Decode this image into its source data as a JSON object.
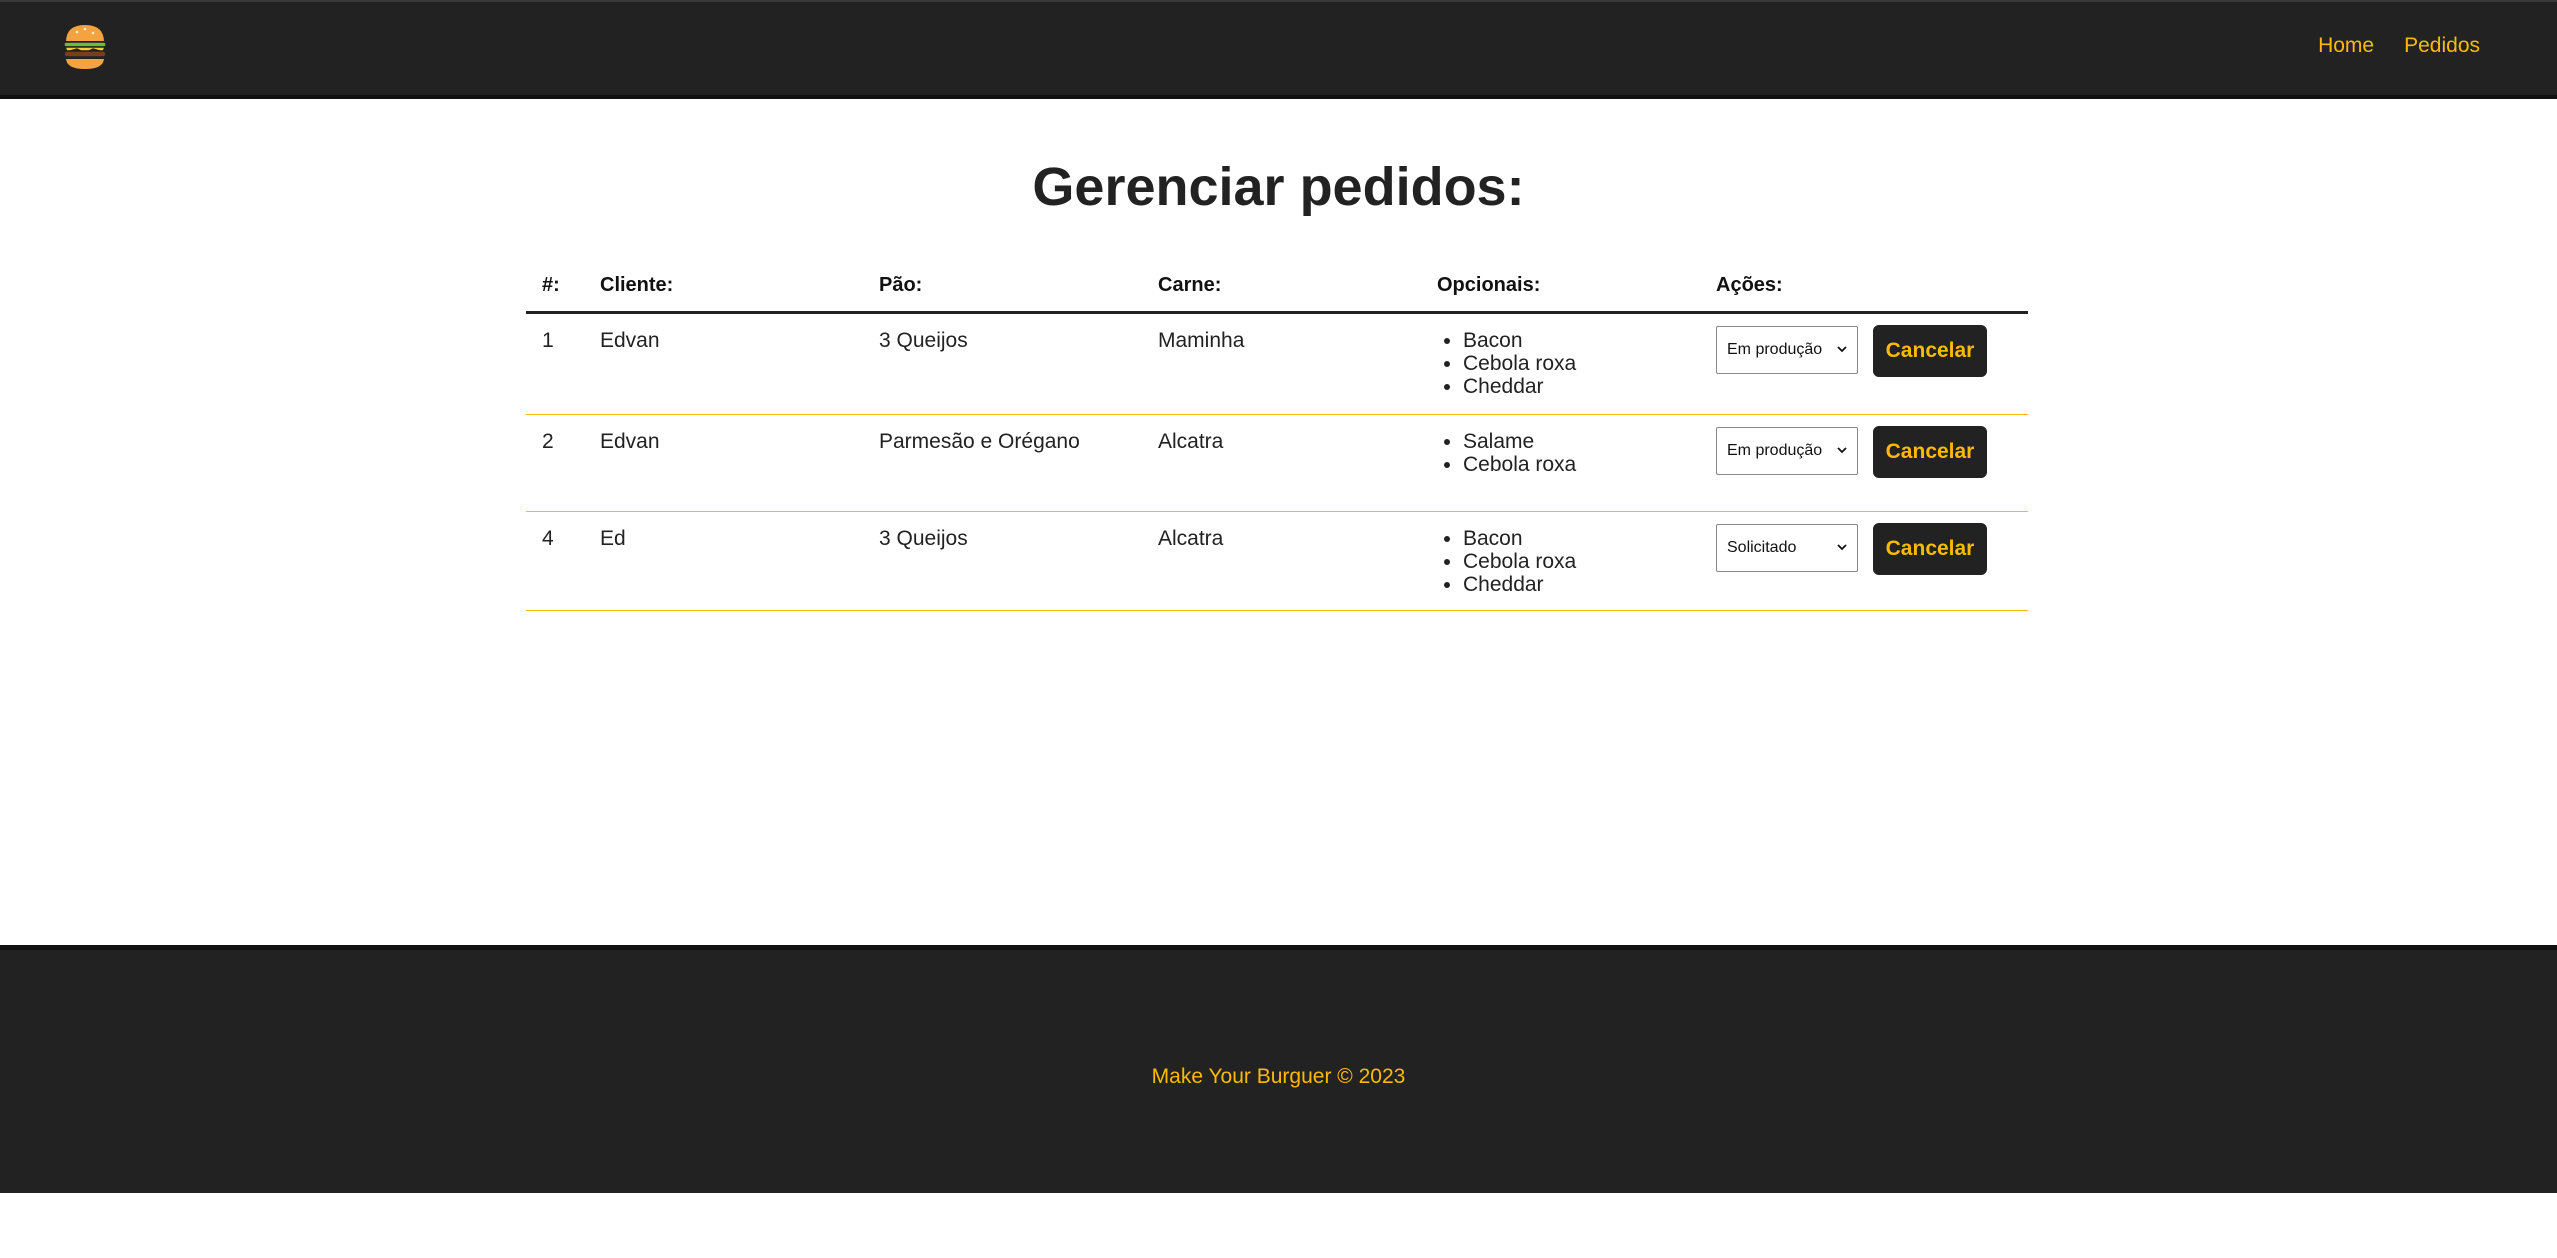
{
  "nav": {
    "logo_icon": "burger-logo-icon",
    "links": [
      "Home",
      "Pedidos"
    ]
  },
  "page": {
    "title": "Gerenciar pedidos:"
  },
  "table": {
    "headers": [
      "#:",
      "Cliente:",
      "Pão:",
      "Carne:",
      "Opcionais:",
      "Ações:"
    ],
    "rows": [
      {
        "id": "1",
        "cliente": "Edvan",
        "pao": "3 Queijos",
        "carne": "Maminha",
        "opcionais": [
          "Bacon",
          "Cebola roxa",
          "Cheddar"
        ],
        "status": "Em produção",
        "cancel": "Cancelar"
      },
      {
        "id": "2",
        "cliente": "Edvan",
        "pao": "Parmesão e Orégano",
        "carne": "Alcatra",
        "opcionais": [
          "Salame",
          "Cebola roxa"
        ],
        "status": "Em produção",
        "cancel": "Cancelar"
      },
      {
        "id": "4",
        "cliente": "Ed",
        "pao": "3 Queijos",
        "carne": "Alcatra",
        "opcionais": [
          "Bacon",
          "Cebola roxa",
          "Cheddar"
        ],
        "status": "Solicitado",
        "cancel": "Cancelar"
      }
    ]
  },
  "footer": {
    "text": "Make Your Burguer © 2023"
  },
  "colors": {
    "dark": "#222222",
    "accent": "#fcba03",
    "white": "#ffffff"
  }
}
